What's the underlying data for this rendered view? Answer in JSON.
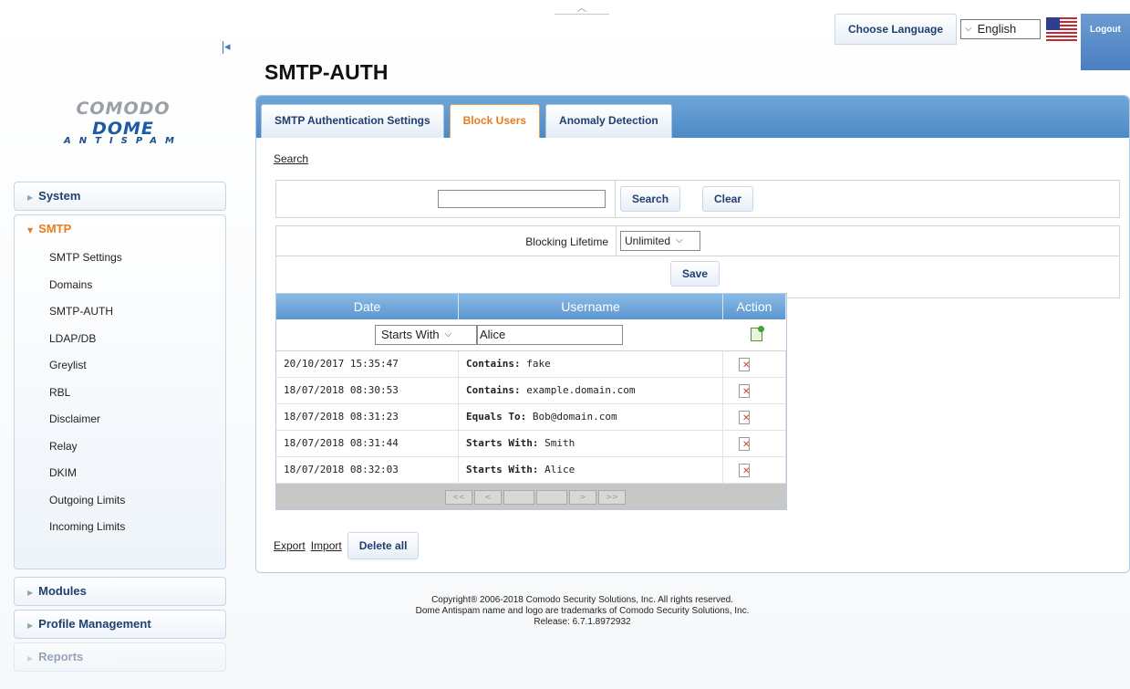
{
  "header": {
    "choose_language_label": "Choose Language",
    "language_value": "English",
    "logout_label": "Logout"
  },
  "logo": {
    "line1a": "COMODO",
    "line1b": "DOME",
    "line2": "ANTISPAM"
  },
  "sidebar": {
    "system": "System",
    "smtp": "SMTP",
    "smtp_items": [
      "SMTP Settings",
      "Domains",
      "SMTP-AUTH",
      "LDAP/DB",
      "Greylist",
      "RBL",
      "Disclaimer",
      "Relay",
      "DKIM",
      "Outgoing Limits",
      "Incoming Limits"
    ],
    "modules": "Modules",
    "profile_management": "Profile Management",
    "reports": "Reports"
  },
  "page": {
    "title": "SMTP-AUTH"
  },
  "tabs": [
    "SMTP Authentication Settings",
    "Block Users",
    "Anomaly Detection"
  ],
  "search": {
    "section_link": "Search",
    "input_value": "",
    "search_button": "Search",
    "clear_button": "Clear"
  },
  "lifetime": {
    "label": "Blocking Lifetime",
    "value": "Unlimited",
    "save_button": "Save"
  },
  "table": {
    "columns": [
      "Date",
      "Username",
      "Action"
    ],
    "filter_mode": "Starts With",
    "filter_value": "Alice",
    "rows": [
      {
        "date": "20/10/2017 15:35:47",
        "type": "Contains:",
        "value": "fake"
      },
      {
        "date": "18/07/2018 08:30:53",
        "type": "Contains:",
        "value": "example.domain.com"
      },
      {
        "date": "18/07/2018 08:31:23",
        "type": "Equals To:",
        "value": "Bob@domain.com"
      },
      {
        "date": "18/07/2018 08:31:44",
        "type": "Starts With:",
        "value": "Smith"
      },
      {
        "date": "18/07/2018 08:32:03",
        "type": "Starts With:",
        "value": "Alice"
      }
    ],
    "pager": [
      "<<",
      "<",
      "",
      "",
      ">",
      ">>"
    ]
  },
  "footer_actions": {
    "export": "Export",
    "import": "Import",
    "delete_all": "Delete all"
  },
  "copyright": {
    "line1": "Copyright® 2006-2018 Comodo Security Solutions, Inc. All rights reserved.",
    "line2": "Dome Antispam name and logo are trademarks of Comodo Security Solutions, Inc.",
    "line3": "Release: 6.7.1.8972932"
  },
  "icons": {
    "collapse": "collapse-left-icon",
    "add": "add-entry-icon",
    "delete": "delete-entry-icon",
    "flag": "us-flag-icon"
  },
  "colors": {
    "accent": "#e87b1e",
    "brand_blue": "#4c8ac6",
    "header_blue": "#5b96d0"
  }
}
